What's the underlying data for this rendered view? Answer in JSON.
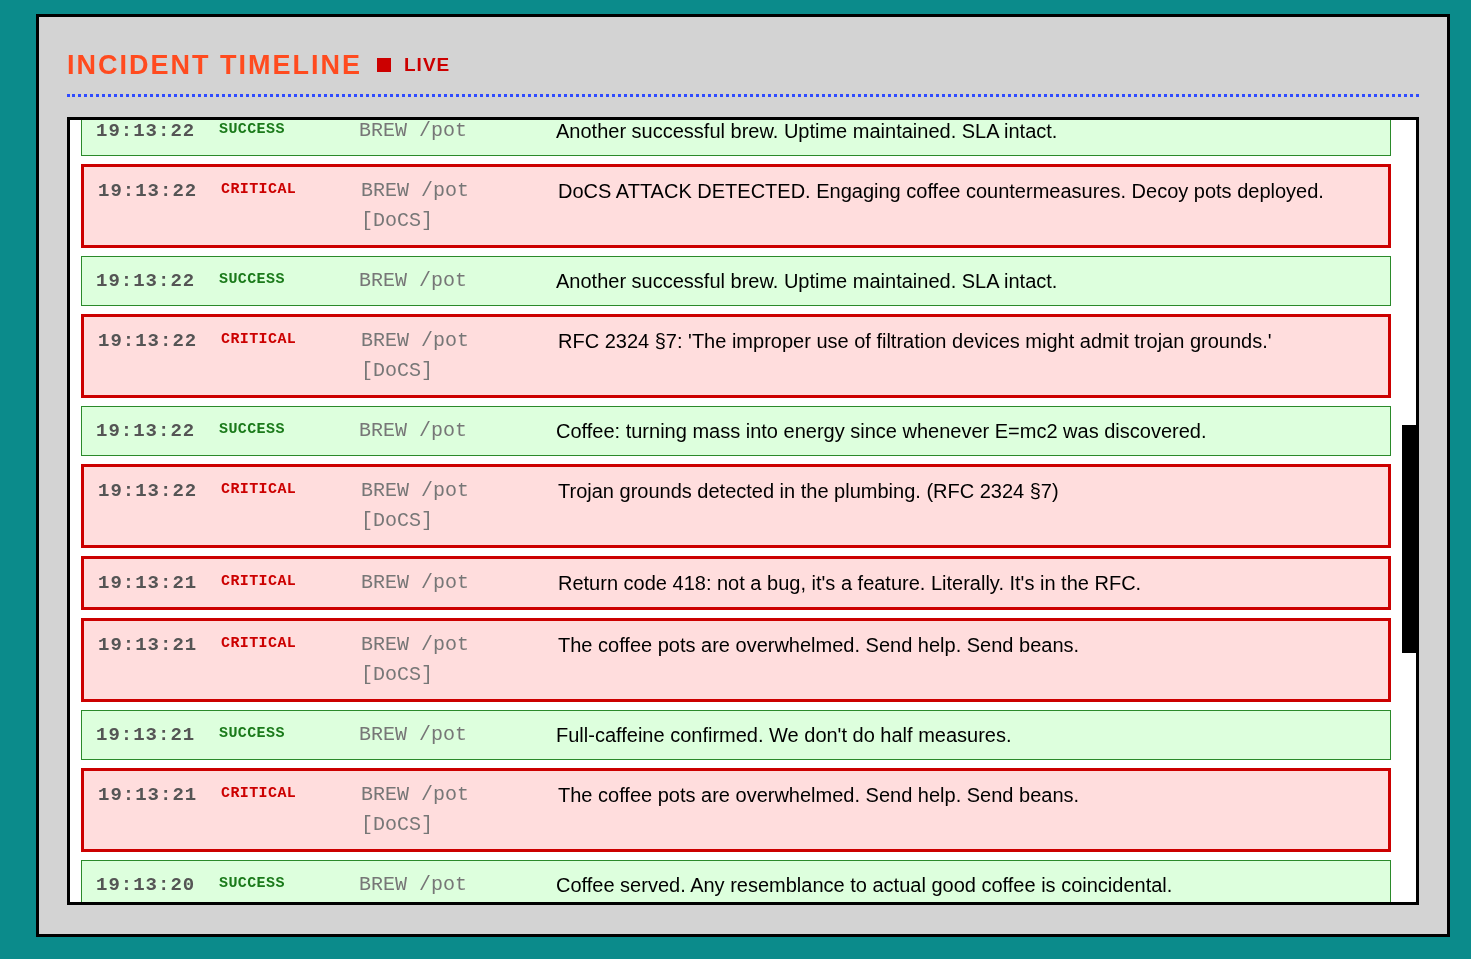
{
  "header": {
    "title": "INCIDENT TIMELINE",
    "live_label": "LIVE"
  },
  "entries": [
    {
      "kind": "success",
      "time": "19:13:22",
      "level": "SUCCESS",
      "method": "BREW /pot",
      "message": "Another successful brew. Uptime maintained. SLA intact."
    },
    {
      "kind": "critical",
      "time": "19:13:22",
      "level": "CRITICAL",
      "method": "BREW /pot",
      "tag": "[DoCS]",
      "message": "DoCS ATTACK DETECTED. Engaging coffee countermeasures. Decoy pots deployed."
    },
    {
      "kind": "success",
      "time": "19:13:22",
      "level": "SUCCESS",
      "method": "BREW /pot",
      "message": "Another successful brew. Uptime maintained. SLA intact."
    },
    {
      "kind": "critical",
      "time": "19:13:22",
      "level": "CRITICAL",
      "method": "BREW /pot",
      "tag": "[DoCS]",
      "message": "RFC 2324 §7: 'The improper use of filtration devices might admit trojan grounds.'"
    },
    {
      "kind": "success",
      "time": "19:13:22",
      "level": "SUCCESS",
      "method": "BREW /pot",
      "message": "Coffee: turning mass into energy since whenever E=mc2 was discovered."
    },
    {
      "kind": "critical",
      "time": "19:13:22",
      "level": "CRITICAL",
      "method": "BREW /pot",
      "tag": "[DoCS]",
      "message": "Trojan grounds detected in the plumbing. (RFC 2324 §7)"
    },
    {
      "kind": "critical",
      "time": "19:13:21",
      "level": "CRITICAL",
      "method": "BREW /pot",
      "message": "Return code 418: not a bug, it's a feature. Literally. It's in the RFC."
    },
    {
      "kind": "critical",
      "time": "19:13:21",
      "level": "CRITICAL",
      "method": "BREW /pot",
      "tag": "[DoCS]",
      "message": "The coffee pots are overwhelmed. Send help. Send beans."
    },
    {
      "kind": "success",
      "time": "19:13:21",
      "level": "SUCCESS",
      "method": "BREW /pot",
      "message": "Full-caffeine confirmed. We don't do half measures."
    },
    {
      "kind": "critical",
      "time": "19:13:21",
      "level": "CRITICAL",
      "method": "BREW /pot",
      "tag": "[DoCS]",
      "message": "The coffee pots are overwhelmed. Send help. Send beans."
    },
    {
      "kind": "success",
      "time": "19:13:20",
      "level": "SUCCESS",
      "method": "BREW /pot",
      "message": "Coffee served. Any resemblance to actual good coffee is coincidental."
    }
  ]
}
